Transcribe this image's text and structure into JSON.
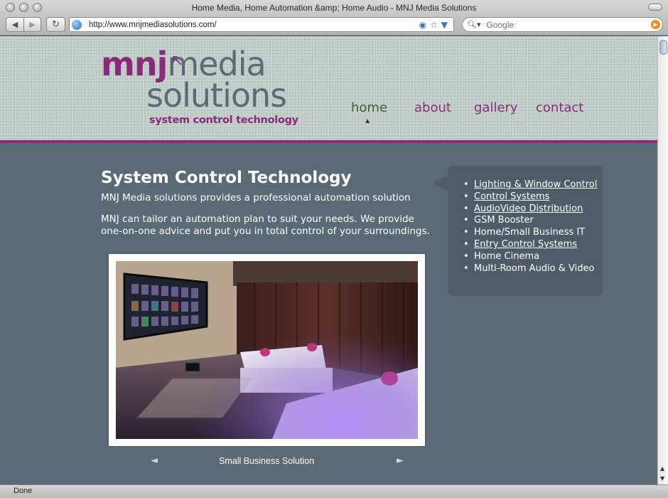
{
  "browser": {
    "window_title": "Home Media, Home Automation &amp; Home Audio - MNJ Media Solutions",
    "url": "http://www.mnjmediasolutions.com/",
    "search_placeholder": "Google",
    "status": "Done"
  },
  "logo": {
    "line1_brand": "mnj",
    "line1_word": "media",
    "line2": "solutions",
    "tagline": "system control technology"
  },
  "nav": {
    "items": [
      {
        "label": "home",
        "active": true
      },
      {
        "label": "about"
      },
      {
        "label": "gallery"
      },
      {
        "label": "contact"
      }
    ]
  },
  "content": {
    "title": "System Control Technology",
    "intro": "MNJ Media solutions provides a professional automation solution",
    "paragraph": "MNJ can tailor an automation plan to suit your needs. We provide one-on-one advice and put you in total control of your surroundings."
  },
  "carousel": {
    "caption": "Small Business Solution",
    "prev": "◄",
    "next": "►"
  },
  "services": [
    {
      "label": "Lighting & Window Control",
      "link": true
    },
    {
      "label": "Control Systems",
      "link": true
    },
    {
      "label": "AudioVideo Distribution",
      "link": true
    },
    {
      "label": "GSM Booster",
      "link": false
    },
    {
      "label": "Home/Small Business IT",
      "link": false
    },
    {
      "label": "Entry Control Systems",
      "link": true
    },
    {
      "label": "Home Cinema",
      "link": false
    },
    {
      "label": "Multi-Room Audio & Video",
      "link": false
    }
  ],
  "colors": {
    "brand_purple": "#8a2a7a",
    "page_background": "#5b6a77",
    "header_background": "#bfcbc8"
  }
}
